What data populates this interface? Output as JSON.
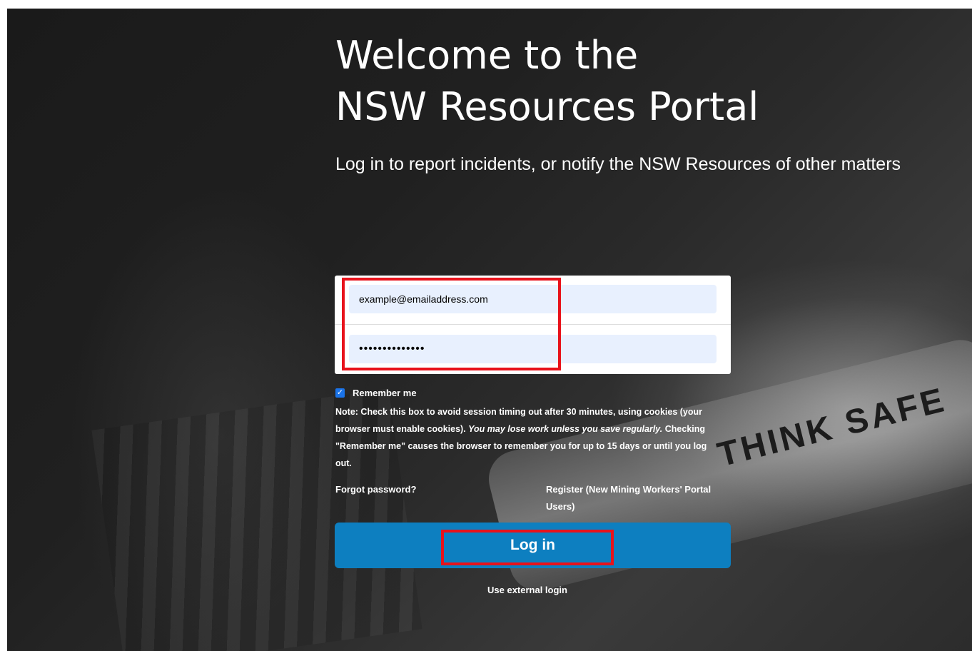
{
  "hero": {
    "title_line1": "Welcome to the",
    "title_line2": "NSW Resources Portal",
    "subtitle": "Log in to report incidents, or notify the NSW Resources of other matters"
  },
  "background": {
    "watermark_text": "THINK SAFE"
  },
  "login_form": {
    "email_value": "example@emailaddress.com",
    "password_value": "••••••••••••••",
    "remember_me_label": "Remember me",
    "remember_me_checked": true,
    "note_label": "Note:",
    "note_text_1": " Check this box to avoid session timing out after 30 minutes, using cookies (your browser must enable cookies). ",
    "note_text_italic": "You may lose work unless you save regularly.",
    "note_text_2": " Checking \"Remember me\" causes the browser to remember you for up to 15 days or until you log out.",
    "forgot_password": "Forgot password?",
    "register": "Register (New Mining Workers' Portal Users)",
    "login_button": "Log in",
    "external_login": "Use external login"
  },
  "annotations": {
    "highlight_color": "#e8121b"
  },
  "colors": {
    "button_blue": "#0d7fc0",
    "input_fill": "#e8f0fe"
  }
}
